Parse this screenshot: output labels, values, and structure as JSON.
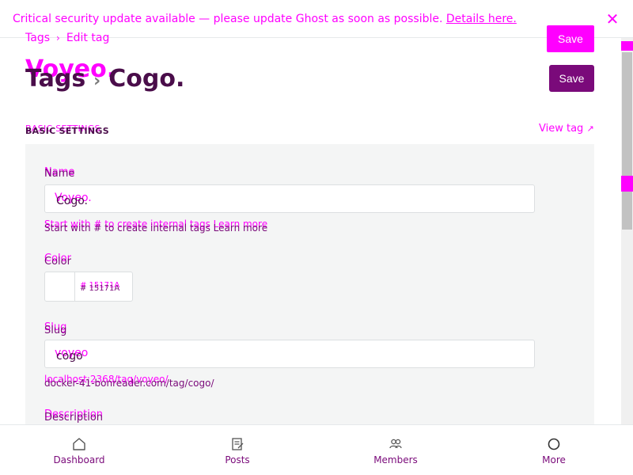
{
  "banner": {
    "text": "Critical security update available — please update Ghost as soon as possible.",
    "link": "Details here."
  },
  "breadcrumb": {
    "root": "Tags",
    "current": "Edit tag"
  },
  "header": {
    "title_ghost": "Voyeo.",
    "title_root": "Tags",
    "title_name": "Cogo.",
    "save_top": "Save",
    "save_main": "Save"
  },
  "section": {
    "label_ghost": "BASIC SETTINGS",
    "label": "BASIC SETTINGS",
    "view_tag": "View tag"
  },
  "fields": {
    "name": {
      "label_ghost": "Name",
      "label": "Name",
      "value_ghost": "Voyeo.",
      "value": "Cogo.",
      "hint_ghost": "Start with # to create internal tags Learn more",
      "hint": "Start with # to create internal tags Learn more"
    },
    "color": {
      "label_ghost": "Color",
      "label": "Color",
      "value_ghost": "# 15171A",
      "value": "# 15171A"
    },
    "slug": {
      "label_ghost": "Slug",
      "label": "Slug",
      "value_ghost": "voyeo",
      "value": "cogo",
      "hint_ghost": "localhost:2368/tag/voyeo/",
      "hint": "docker-41-bonreader.com/tag/cogo/"
    },
    "description": {
      "label_ghost": "Description",
      "label": "Description"
    }
  },
  "nav": {
    "items": [
      {
        "label": "Dashboard",
        "icon": "home-icon"
      },
      {
        "label": "Posts",
        "icon": "posts-icon"
      },
      {
        "label": "Members",
        "icon": "members-icon"
      },
      {
        "label": "More",
        "icon": "more-icon"
      }
    ]
  },
  "colors": {
    "accent": "#ff00ff",
    "primary": "#7a0a7a",
    "swatch": "#15171A"
  }
}
